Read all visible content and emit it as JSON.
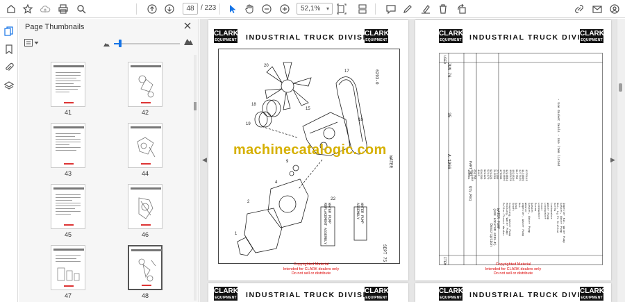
{
  "toolbar": {
    "current_page": "48",
    "total_pages": "/ 223",
    "zoom": "52,1%"
  },
  "panel": {
    "title": "Page Thumbnails",
    "thumbnails": [
      {
        "label": "41"
      },
      {
        "label": "42"
      },
      {
        "label": "43"
      },
      {
        "label": "44"
      },
      {
        "label": "45"
      },
      {
        "label": "46"
      },
      {
        "label": "47"
      },
      {
        "label": "48"
      }
    ],
    "selected_page": "48",
    "thumbnail_size_fraction": 0.1
  },
  "document": {
    "division_title": "INDUSTRIAL TRUCK DIVISION",
    "logo_text": "CLARK",
    "logo_sub": "EQUIPMENT",
    "watermark": "machinecatalogic.com",
    "copyright_lines": [
      "Copyrighted Material",
      "Intended for CLARK dealers only",
      "Do not sell or distribute"
    ],
    "left_page": {
      "fig_number": "6293-0",
      "callout_a": "WATER PUMP REPLACEMENT ASSEMBLY",
      "callout_b": "WATER PUMP ASSEMBLY",
      "callout_num": "22",
      "footer": "SEPT 75",
      "side": "WATER"
    },
    "right_page": {
      "date": "JUN 76",
      "num": "35",
      "code": "A-1966",
      "group": "WATER PUMP",
      "group_sub": "(USE LOCATOR 6285-F)",
      "note": "- Use Gasket Seals - Use ltem listed",
      "col_part": "PART NO",
      "col_desc": "Description",
      "col_qty": "Qty.Req",
      "parts": [
        "180661",
        "1821488",
        "251758",
        "4412",
        "994399",
        "921124",
        "921179",
        "921223",
        "213556",
        "274180",
        "170098",
        "1824660",
        "1224684",
        "1825178",
        "1621540",
        "917750",
        "1277155",
        "1174800",
        "1275113"
      ],
      "descriptions": [
        "Puller-Thrust Washer",
        "Housing, Water Pump",
        "Coupling, Water Pump",
        "Shaft",
        "Seal",
        "Nut",
        "Impeller, Water Pump",
        "Washer",
        "Gasket, Water Pump",
        "Gasket",
        "Screw",
        "Lockwasher",
        "Cover",
        "Lockwasher",
        "Water Pump",
        "Lockwasher",
        "Screw",
        "Nut, Lg Pt Drilled",
        "Gasket, Water Pump",
        "Impeller Kit, Water Pump"
      ],
      "item_col": "ITEM",
      "used_col": "USED"
    }
  },
  "colors": {
    "accent": "#1473e6",
    "watermark": "#d6b000",
    "copyright_red": "#dd0000"
  },
  "icons": [
    "home-icon",
    "star-icon",
    "cloud-upload-icon",
    "print-icon",
    "search-icon",
    "page-up-icon",
    "page-down-icon",
    "cursor-icon",
    "hand-icon",
    "zoom-out-icon",
    "zoom-in-icon",
    "page-fit-icon",
    "scroll-mode-icon",
    "comment-icon",
    "pen-icon",
    "highlight-icon",
    "delete-icon",
    "rotate-icon",
    "share-icon",
    "email-icon",
    "user-icon"
  ]
}
